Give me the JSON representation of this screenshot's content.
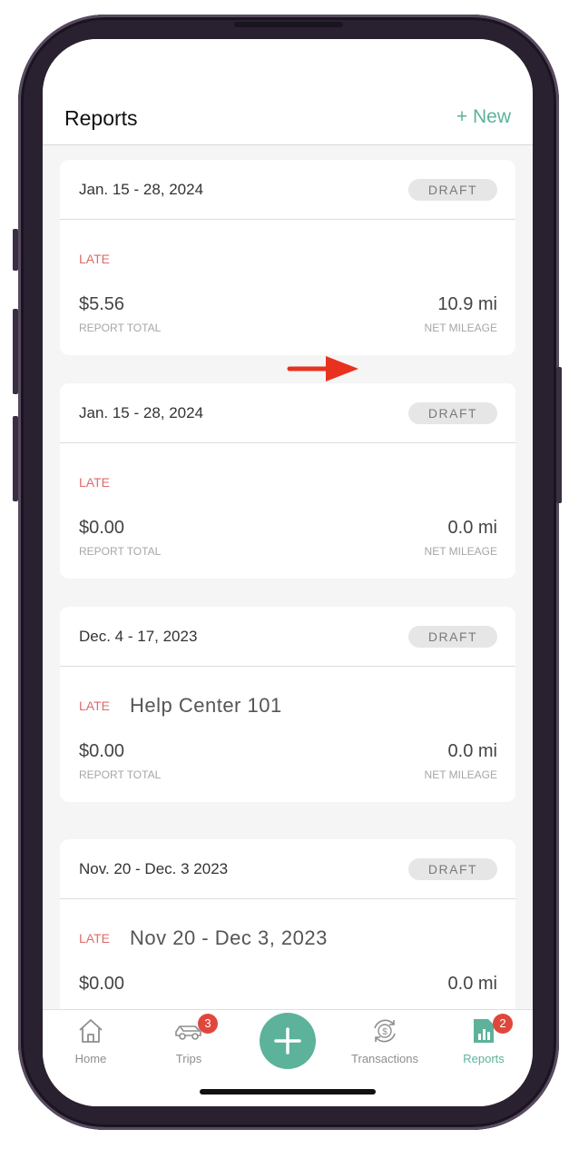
{
  "header": {
    "title": "Reports",
    "new_label": "+ New"
  },
  "cards": [
    {
      "date": "Jan. 15 - 28, 2024",
      "status": "DRAFT",
      "late": "LATE",
      "name": "",
      "total": "$5.56",
      "total_label": "REPORT TOTAL",
      "mileage": "10.9 mi",
      "mileage_label": "NET MILEAGE"
    },
    {
      "date": "Jan. 15 - 28, 2024",
      "status": "DRAFT",
      "late": "LATE",
      "name": "",
      "total": "$0.00",
      "total_label": "REPORT TOTAL",
      "mileage": "0.0 mi",
      "mileage_label": "NET MILEAGE"
    },
    {
      "date": "Dec. 4 - 17, 2023",
      "status": "DRAFT",
      "late": "LATE",
      "name": "Help Center 101",
      "total": "$0.00",
      "total_label": "REPORT TOTAL",
      "mileage": "0.0 mi",
      "mileage_label": "NET MILEAGE"
    },
    {
      "date": "Nov. 20 - Dec. 3 2023",
      "status": "DRAFT",
      "late": "LATE",
      "name": "Nov 20 - Dec 3, 2023",
      "total": "$0.00",
      "total_label": "",
      "mileage": "0.0 mi",
      "mileage_label": ""
    }
  ],
  "tabs": [
    {
      "label": "Home",
      "icon": "home-icon",
      "badge": ""
    },
    {
      "label": "Trips",
      "icon": "car-icon",
      "badge": "3"
    },
    {
      "label": "Transactions",
      "icon": "dollar-sync-icon",
      "badge": ""
    },
    {
      "label": "Reports",
      "icon": "bar-chart-icon",
      "badge": "2"
    }
  ],
  "colors": {
    "accent": "#5db29b",
    "late": "#e06a6a",
    "badge": "#e0473c",
    "arrow": "#e8321f"
  }
}
